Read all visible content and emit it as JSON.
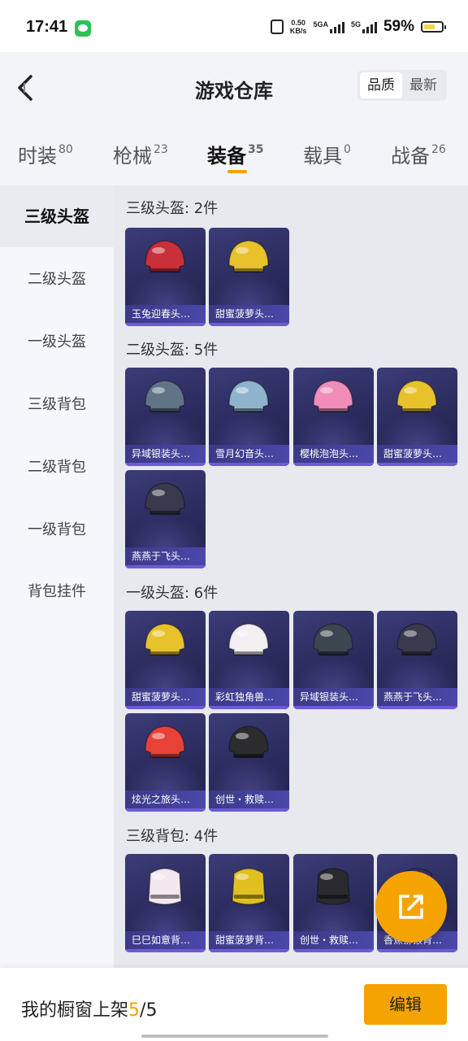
{
  "status": {
    "time": "17:41",
    "net_speed": "0.50",
    "net_unit": "KB/s",
    "sim1": "5GA",
    "sim2": "5G",
    "battery": "59%"
  },
  "header": {
    "title": "游戏仓库",
    "sort_options": [
      "品质",
      "最新"
    ],
    "active_sort": "品质"
  },
  "tabs": [
    {
      "label": "时装",
      "count": "80"
    },
    {
      "label": "枪械",
      "count": "23"
    },
    {
      "label": "装备",
      "count": "35"
    },
    {
      "label": "载具",
      "count": "0"
    },
    {
      "label": "战备",
      "count": "26"
    }
  ],
  "active_tab": "装备",
  "sidebar": {
    "items": [
      "三级头盔",
      "二级头盔",
      "一级头盔",
      "三级背包",
      "二级背包",
      "一级背包",
      "背包挂件"
    ],
    "active": "三级头盔"
  },
  "sections": [
    {
      "title": "三级头盔: 2件",
      "items": [
        {
          "name": "玉兔迎春头…",
          "color": "#c8303a"
        },
        {
          "name": "甜蜜菠萝头…",
          "color": "#e8c22c"
        }
      ]
    },
    {
      "title": "二级头盔: 5件",
      "items": [
        {
          "name": "异域银装头…",
          "color": "#5f7486"
        },
        {
          "name": "雪月幻音头…",
          "color": "#8fb3cc"
        },
        {
          "name": "樱桃泡泡头…",
          "color": "#f08db8"
        },
        {
          "name": "甜蜜菠萝头…",
          "color": "#e8c22c"
        },
        {
          "name": "燕燕于飞头…",
          "color": "#3a3a4e"
        }
      ]
    },
    {
      "title": "一级头盔: 6件",
      "items": [
        {
          "name": "甜蜜菠萝头…",
          "color": "#e8c22c"
        },
        {
          "name": "彩虹独角兽…",
          "color": "#f2eef2"
        },
        {
          "name": "异域银装头…",
          "color": "#3c4650"
        },
        {
          "name": "燕燕于飞头…",
          "color": "#3a3a4e"
        },
        {
          "name": "炫光之旅头…",
          "color": "#e84238"
        },
        {
          "name": "创世・救赎…",
          "color": "#2c2c2e"
        }
      ]
    },
    {
      "title": "三级背包: 4件",
      "items": [
        {
          "name": "巳巳如意背…",
          "color": "#f4e8ee"
        },
        {
          "name": "甜蜜菠萝背…",
          "color": "#e0c020"
        },
        {
          "name": "创世・救赎…",
          "color": "#2a2a2e"
        },
        {
          "name": "香蕉猕猴背…",
          "color": "#3a3060"
        }
      ]
    }
  ],
  "bottom": {
    "label": "我的橱窗上架",
    "count_current": "5",
    "count_sep": "/",
    "count_total": "5",
    "edit_label": "编辑"
  },
  "colors": {
    "accent": "#f5a300",
    "card_bg": "#2e2e64"
  }
}
